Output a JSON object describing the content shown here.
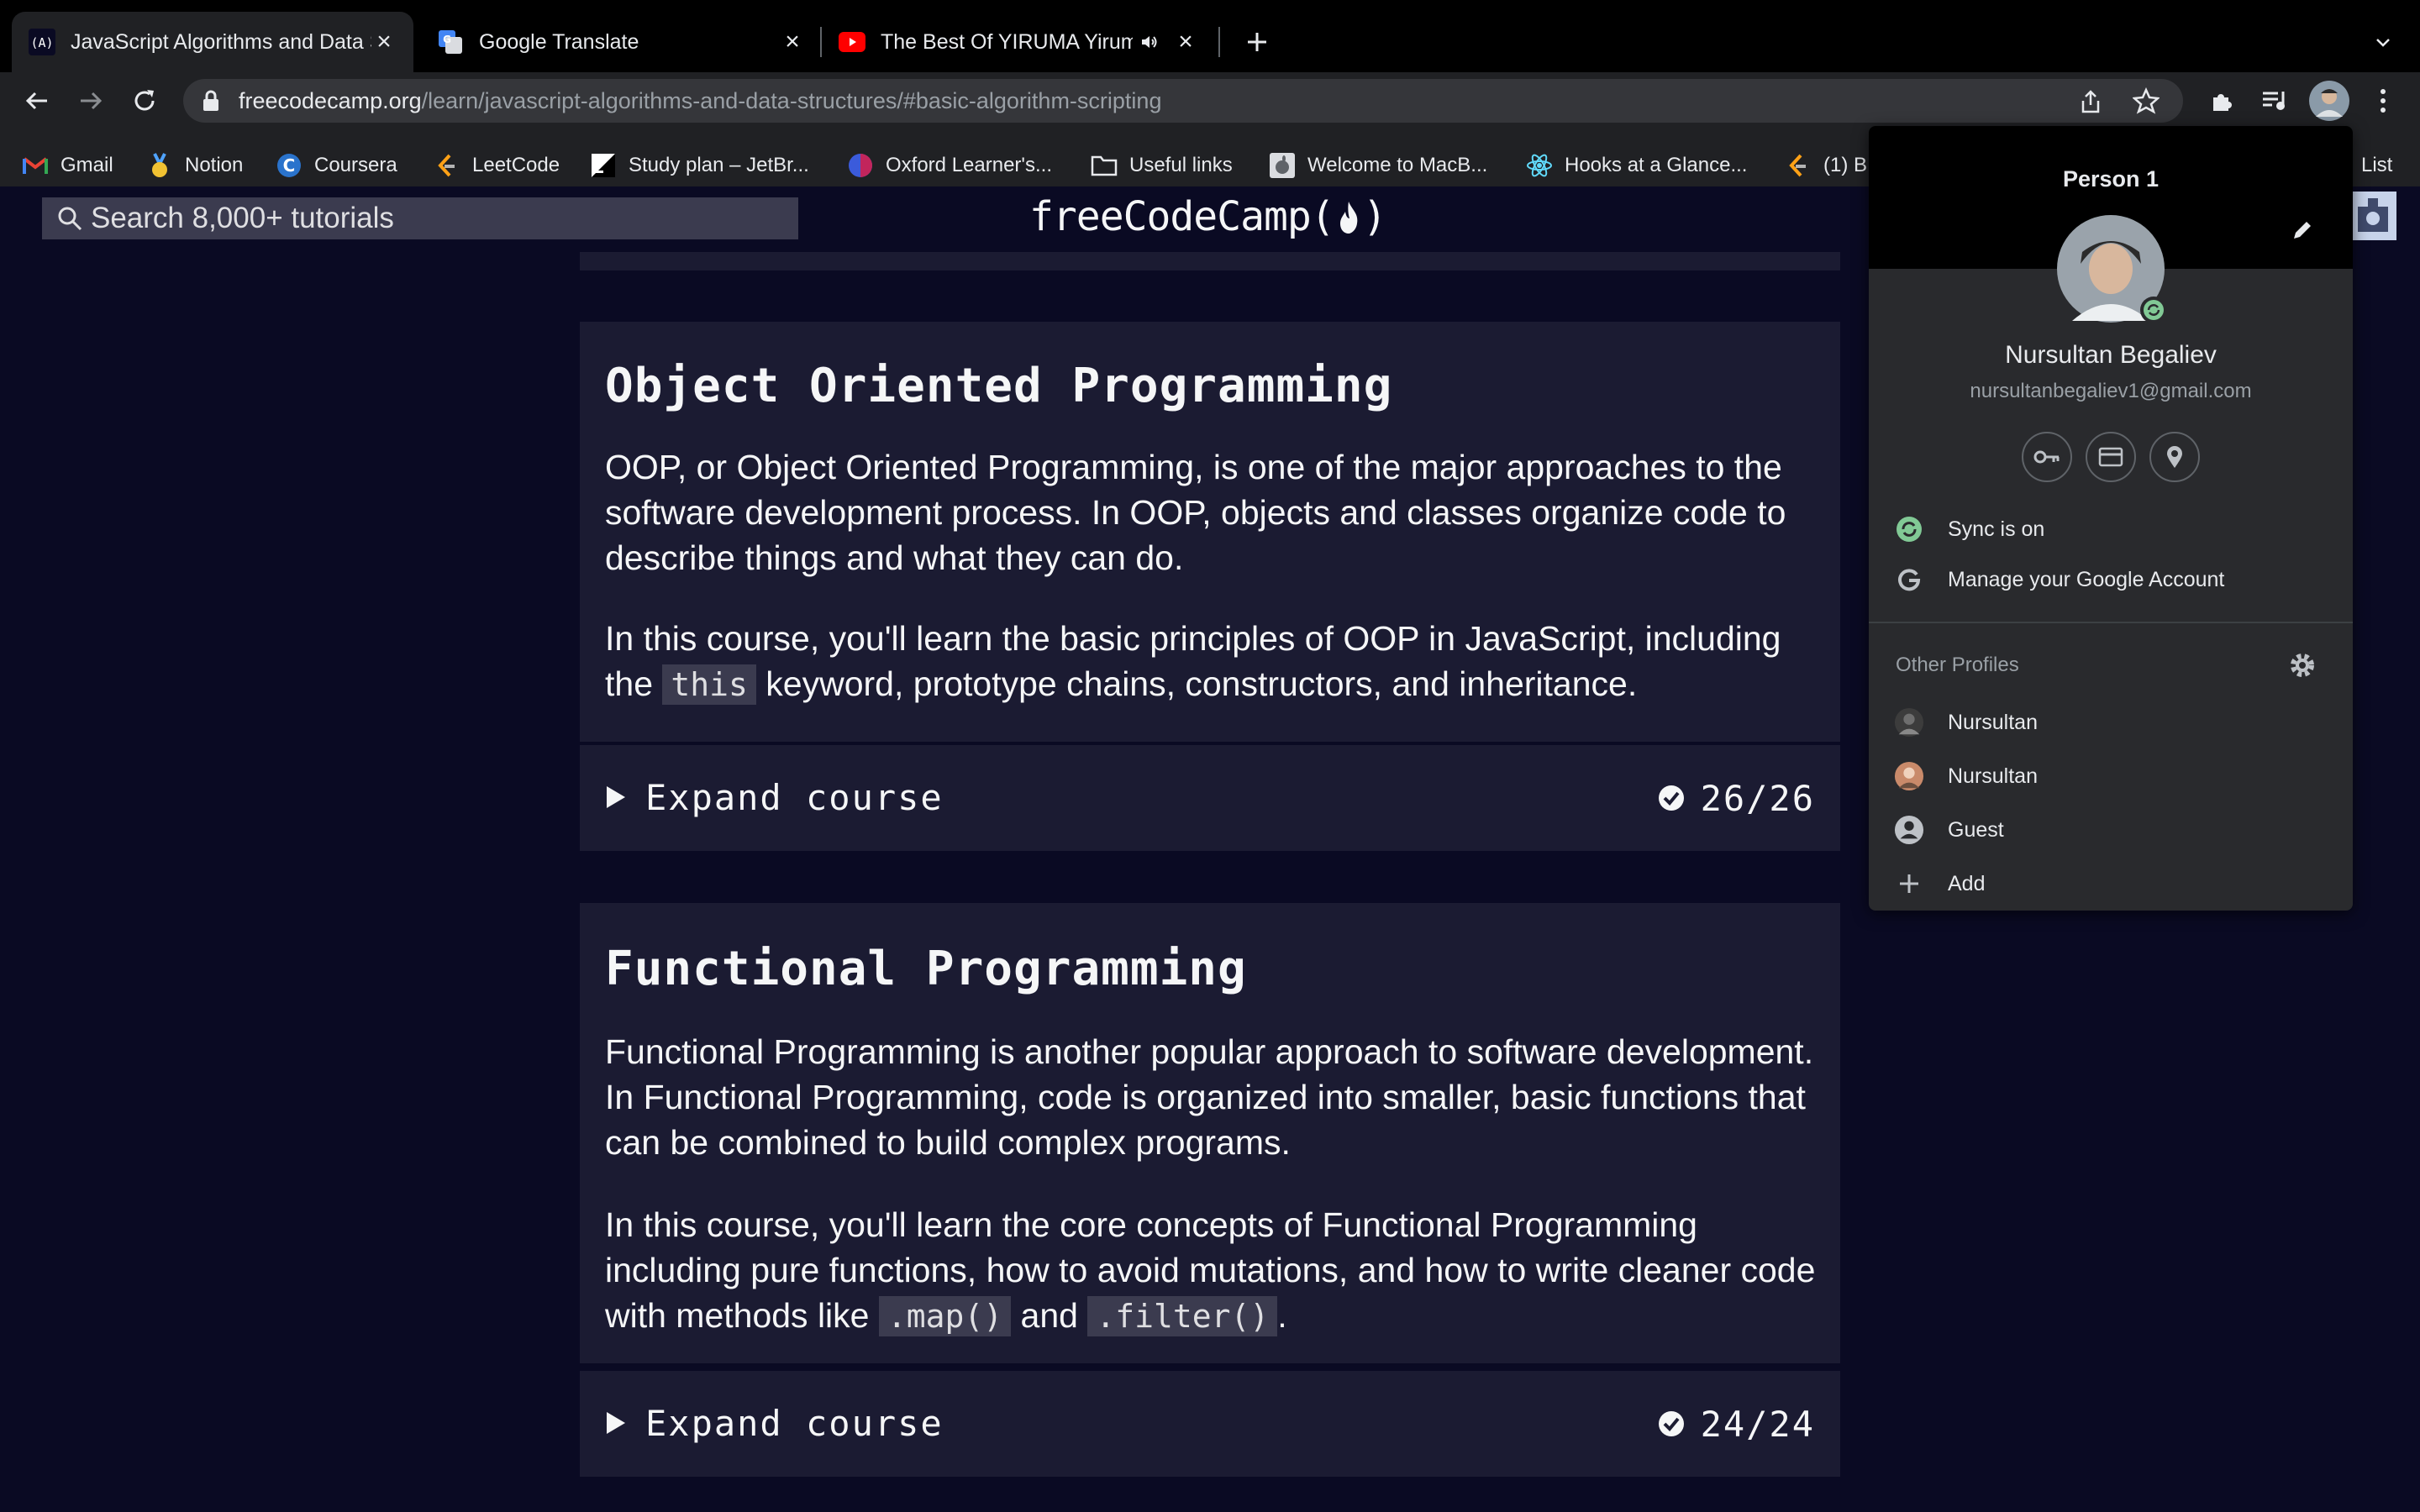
{
  "tabs": [
    {
      "title": "JavaScript Algorithms and Data Structures",
      "favicon": "freecodecamp-icon",
      "active": true
    },
    {
      "title": "Google Translate",
      "favicon": "google-translate-icon",
      "active": false
    },
    {
      "title": "The Best Of YIRUMA Yiruma",
      "favicon": "youtube-icon",
      "active": false,
      "audio": true
    }
  ],
  "address_bar": {
    "domain": "freecodecamp.org",
    "path": "/learn/javascript-algorithms-and-data-structures/#basic-algorithm-scripting"
  },
  "bookmarks": [
    {
      "label": "Gmail",
      "icon": "gmail-icon"
    },
    {
      "label": "Notion",
      "icon": "medal-icon"
    },
    {
      "label": "Coursera",
      "icon": "coursera-icon"
    },
    {
      "label": "LeetCode",
      "icon": "leetcode-icon"
    },
    {
      "label": "Study plan – JetBr...",
      "icon": "jetbrains-icon"
    },
    {
      "label": "Oxford Learner's...",
      "icon": "oxford-icon"
    },
    {
      "label": "Useful links",
      "icon": "folder-icon"
    },
    {
      "label": "Welcome to MacB...",
      "icon": "apple-icon"
    },
    {
      "label": "Hooks at a Glance...",
      "icon": "react-icon"
    },
    {
      "label": "(1) B",
      "icon": "leetcode-icon"
    },
    {
      "label": "List",
      "icon": ""
    }
  ],
  "fcc": {
    "search_placeholder": "Search 8,000+ tutorials",
    "logo_text": "freeCodeCamp("
  },
  "courses": [
    {
      "title": "Object Oriented Programming",
      "p1": "OOP, or Object Oriented Programming, is one of the major approaches to the software development process. In OOP, objects and classes organize code to describe things and what they can do.",
      "p2_a": "In this course, you'll learn the basic principles of OOP in JavaScript, including the ",
      "p2_code": "this",
      "p2_b": " keyword, prototype chains, constructors, and inheritance.",
      "expand_label": "Expand course",
      "progress": "26/26"
    },
    {
      "title": "Functional Programming",
      "p1": "Functional Programming is another popular approach to software development. In Functional Programming, code is organized into smaller, basic functions that can be combined to build complex programs.",
      "p2_a": "In this course, you'll learn the core concepts of Functional Programming including pure functions, how to avoid mutations, and how to write cleaner code with methods like ",
      "p2_code1": ".map()",
      "p2_mid": " and ",
      "p2_code2": ".filter()",
      "p2_end": ".",
      "expand_label": "Expand course",
      "progress": "24/24"
    }
  ],
  "profile_menu": {
    "header": "Person 1",
    "name": "Nursultan Begaliev",
    "email": "nursultanbegaliev1@gmail.com",
    "sync": "Sync is on",
    "manage": "Manage your Google Account",
    "other_profiles_label": "Other Profiles",
    "others": [
      "Nursultan",
      "Nursultan",
      "Guest"
    ],
    "add": "Add"
  }
}
